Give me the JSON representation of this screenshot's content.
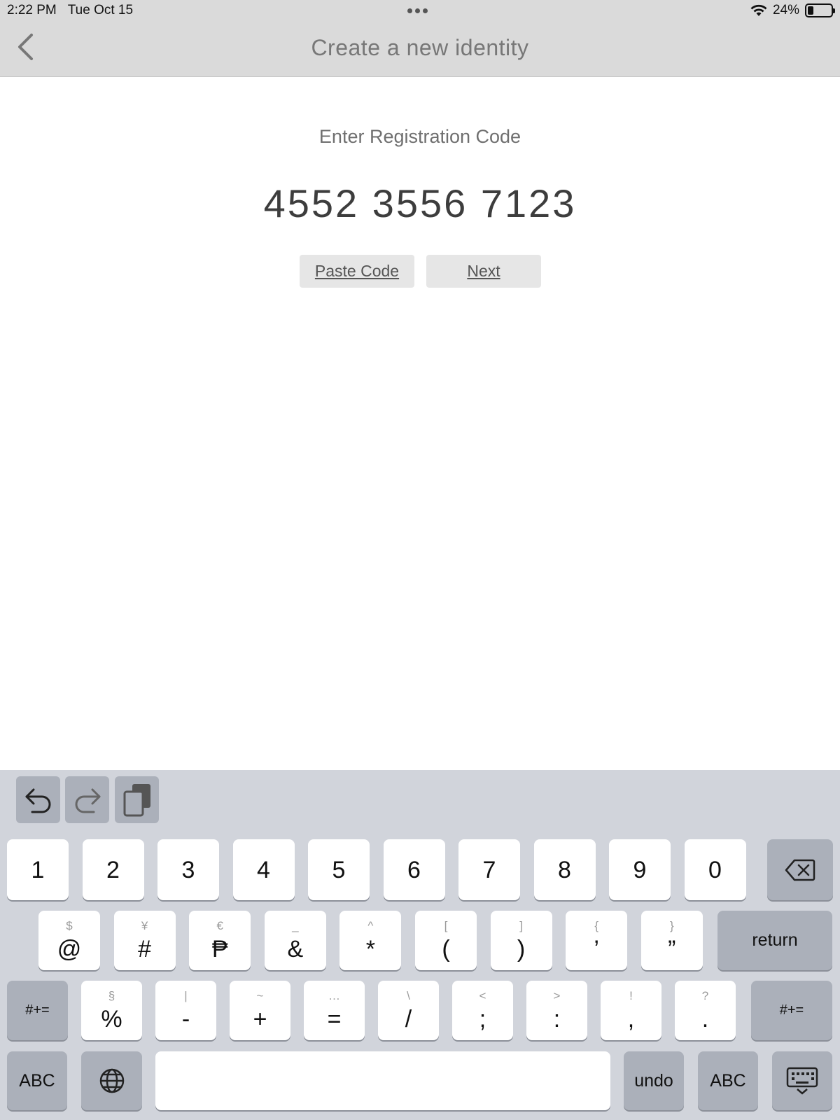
{
  "status_bar": {
    "time": "2:22 PM",
    "date": "Tue Oct 15",
    "battery_percent": "24%",
    "battery_level": 0.24
  },
  "nav": {
    "title": "Create a new identity",
    "back_icon": "chevron-left-icon"
  },
  "main": {
    "prompt": "Enter Registration Code",
    "code": "4552 3556 7123",
    "paste_label": "Paste Code",
    "next_label": "Next"
  },
  "keyboard": {
    "toolbar": [
      "undo-icon",
      "redo-icon",
      "clipboard-icon"
    ],
    "row1": [
      "1",
      "2",
      "3",
      "4",
      "5",
      "6",
      "7",
      "8",
      "9",
      "0"
    ],
    "row2": [
      {
        "main": "@",
        "alt": "$"
      },
      {
        "main": "#",
        "alt": "¥"
      },
      {
        "main": "₱",
        "alt": "€"
      },
      {
        "main": "&",
        "alt": "_"
      },
      {
        "main": "*",
        "alt": "^"
      },
      {
        "main": "(",
        "alt": "["
      },
      {
        "main": ")",
        "alt": "]"
      },
      {
        "main": "’",
        "alt": "{"
      },
      {
        "main": "”",
        "alt": "}"
      }
    ],
    "row3": [
      {
        "main": "%",
        "alt": "§"
      },
      {
        "main": "-",
        "alt": "|"
      },
      {
        "main": "+",
        "alt": "~"
      },
      {
        "main": "=",
        "alt": "…"
      },
      {
        "main": "/",
        "alt": "\\"
      },
      {
        "main": ";",
        "alt": "<"
      },
      {
        "main": ":",
        "alt": ">"
      },
      {
        "main": ",",
        "alt": "!"
      },
      {
        "main": ".",
        "alt": "?"
      }
    ],
    "return_label": "return",
    "shift_label": "#+=",
    "abc_label": "ABC",
    "undo_label": "undo",
    "globe_icon": "globe-icon",
    "delete_icon": "delete-icon",
    "dismiss_icon": "keyboard-dismiss-icon"
  }
}
